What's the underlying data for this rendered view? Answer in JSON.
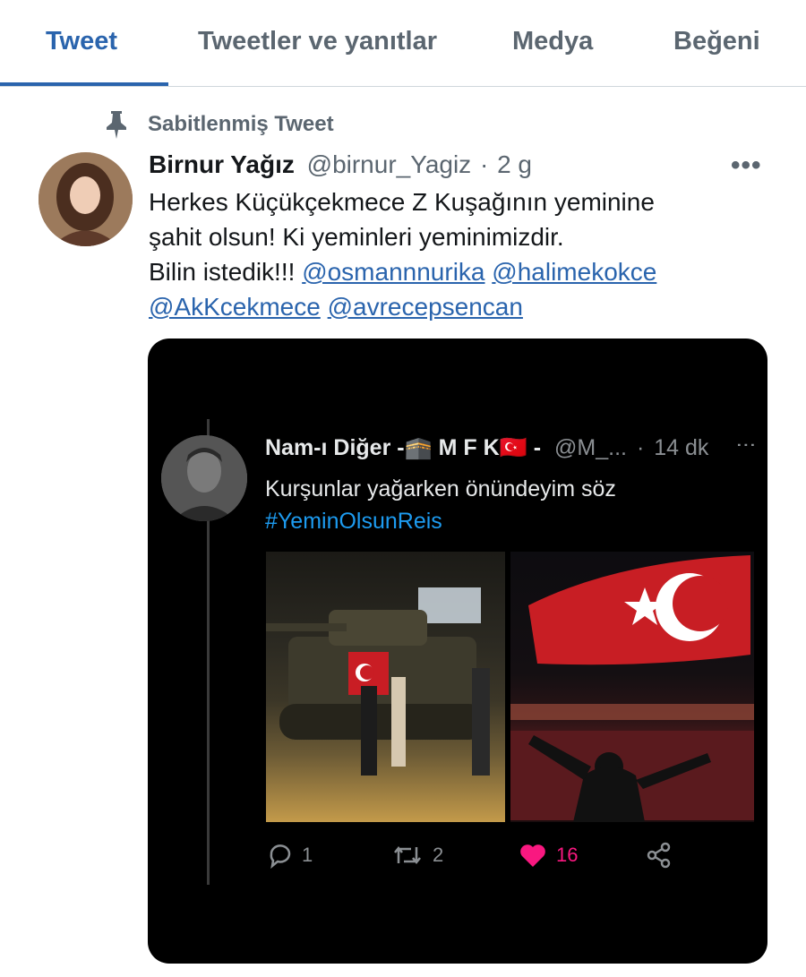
{
  "tabs": [
    {
      "label": "Tweet",
      "active": true
    },
    {
      "label": "Tweetler ve yanıtlar",
      "active": false
    },
    {
      "label": "Medya",
      "active": false
    },
    {
      "label": "Beğeni",
      "active": false
    }
  ],
  "pinned": {
    "label": "Sabitlenmiş Tweet",
    "icon": "pin-icon"
  },
  "tweet": {
    "author_name": "Birnur Yağız",
    "handle": "@birnur_Yagiz",
    "separator": "·",
    "time": "2 g",
    "more_label": "•••",
    "text_line1": "Herkes Küçükçekmece Z Kuşağının yeminine",
    "text_line2": "şahit olsun! Ki yeminleri yeminimizdir.",
    "text_line3_prefix": "Bilin istedik!!!",
    "mentions": [
      "@osmannnurika",
      "@halimekokce",
      "@AkKcekmece",
      "@avrecepsencan"
    ]
  },
  "embedded": {
    "author_name": "Nam-ı Diğer -🕋 M F K🇹🇷 -",
    "handle": "@M_...",
    "separator": "·",
    "time": "14 dk",
    "more_label": "⋮",
    "text": "Kurşunlar yağarken önündeyim söz",
    "hashtag": "#YeminOlsunReis",
    "photos": [
      "tank-at-night-photo",
      "flag-crowd-photo"
    ],
    "actions": {
      "replies": "1",
      "retweets": "2",
      "likes": "16"
    }
  },
  "colors": {
    "accent": "#2a64ad",
    "muted": "#5b6670",
    "like": "#f91880",
    "hashtag_dark": "#1d9bf0"
  }
}
